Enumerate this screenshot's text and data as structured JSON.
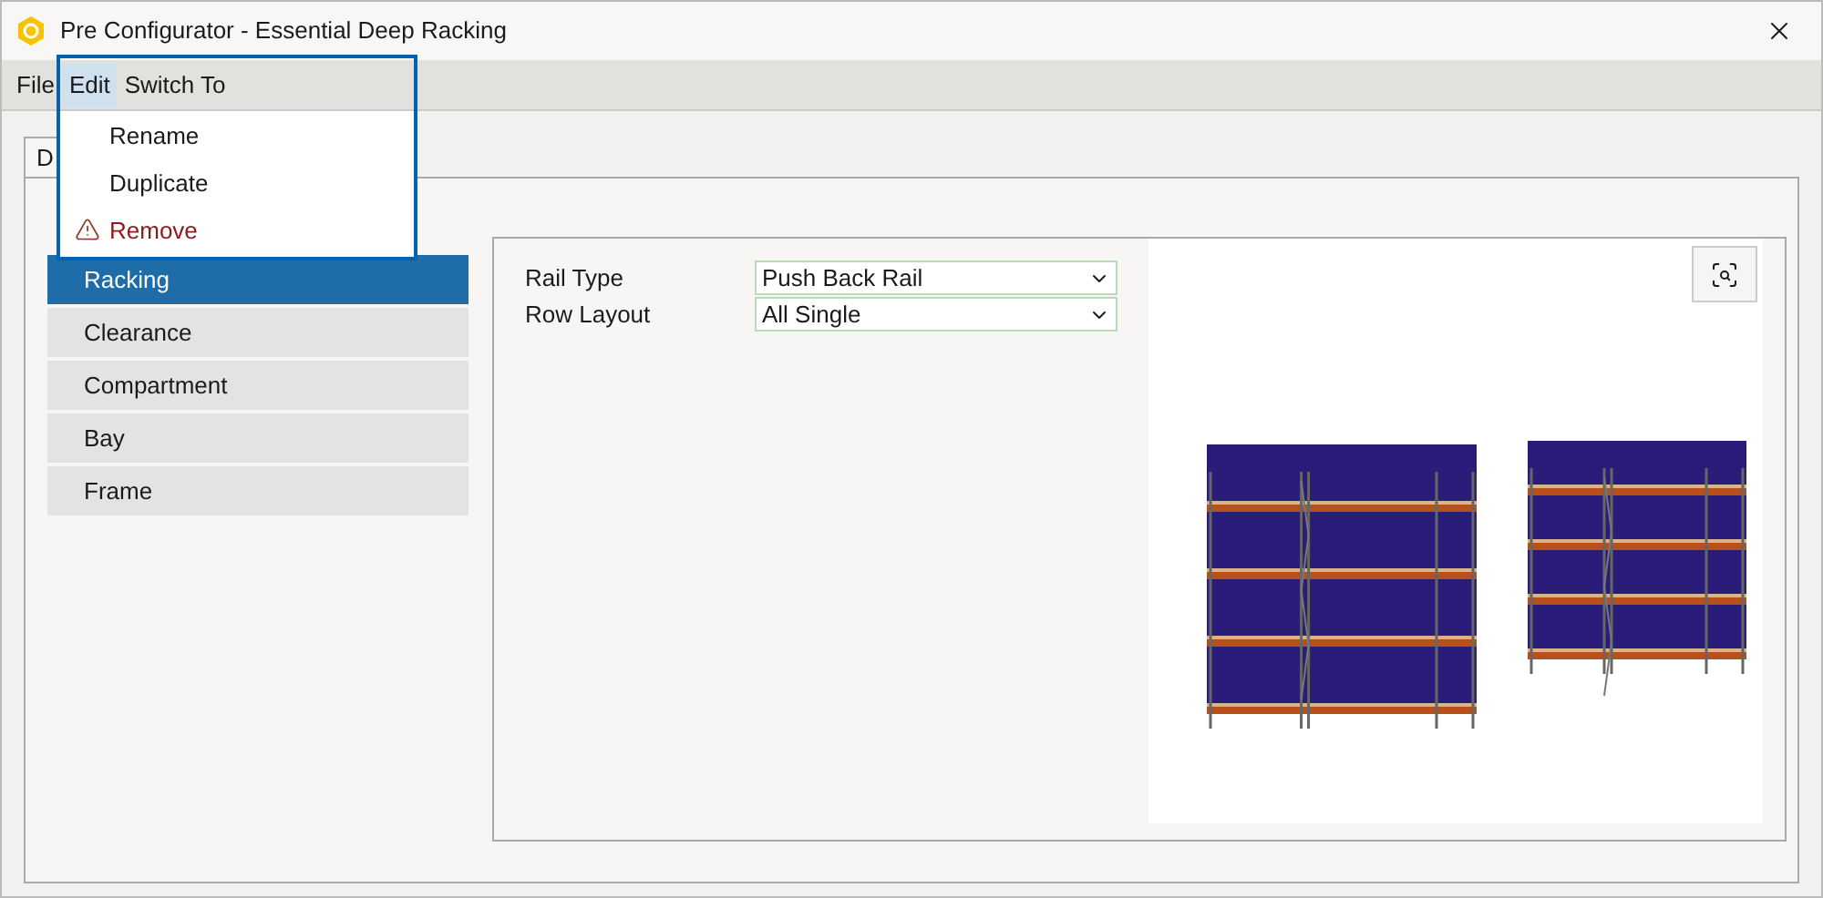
{
  "window": {
    "title": "Pre Configurator - Essential Deep Racking"
  },
  "menu_bar": [
    {
      "label": "File",
      "selected": false
    },
    {
      "label": "Edit",
      "selected": true
    },
    {
      "label": "Switch To",
      "selected": false
    }
  ],
  "dropdown": [
    {
      "label": "Rename",
      "kind": "plain"
    },
    {
      "label": "Duplicate",
      "kind": "plain"
    },
    {
      "label": "Remove",
      "kind": "danger"
    }
  ],
  "tabs": [
    {
      "label": "D",
      "selected": true
    }
  ],
  "sidebar": {
    "items": [
      {
        "label": "Racking",
        "selected": true
      },
      {
        "label": "Clearance",
        "selected": false
      },
      {
        "label": "Compartment",
        "selected": false
      },
      {
        "label": "Bay",
        "selected": false
      },
      {
        "label": "Frame",
        "selected": false
      }
    ]
  },
  "form": [
    {
      "label": "Rail Type",
      "value": "Push Back Rail"
    },
    {
      "label": "Row Layout",
      "value": "All Single"
    }
  ]
}
